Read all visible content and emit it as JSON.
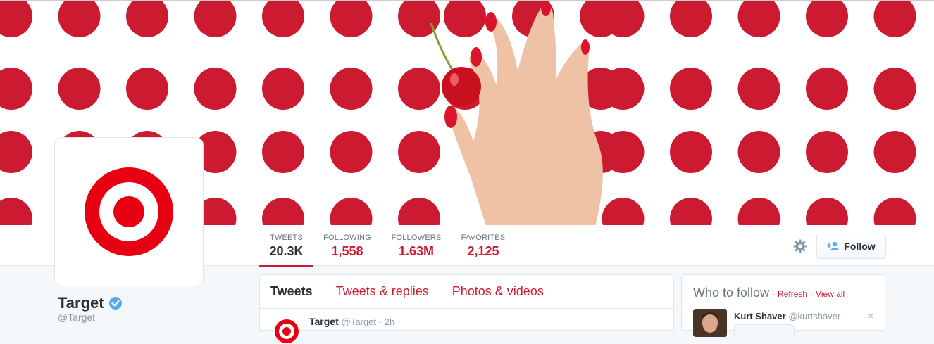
{
  "profile": {
    "name": "Target",
    "handle": "@Target",
    "brand_color": "#cc1b31"
  },
  "stats": [
    {
      "label": "TWEETS",
      "value": "20.3K",
      "active": true
    },
    {
      "label": "FOLLOWING",
      "value": "1,558",
      "active": false
    },
    {
      "label": "FOLLOWERS",
      "value": "1.63M",
      "active": false
    },
    {
      "label": "FAVORITES",
      "value": "2,125",
      "active": false
    }
  ],
  "actions": {
    "follow_label": "Follow",
    "settings_icon": "gear-icon"
  },
  "timeline": {
    "tabs": [
      {
        "label": "Tweets",
        "active": true
      },
      {
        "label": "Tweets & replies",
        "active": false
      },
      {
        "label": "Photos & videos",
        "active": false
      }
    ],
    "first_tweet": {
      "author": "Target",
      "handle": "@Target",
      "time": "· 2h"
    }
  },
  "who_to_follow": {
    "title": "Who to follow",
    "separator": "·",
    "refresh_label": "Refresh",
    "view_all_label": "View all",
    "user": {
      "name": "Kurt Shaver",
      "handle": "@kurtshaver",
      "close": "×"
    }
  }
}
